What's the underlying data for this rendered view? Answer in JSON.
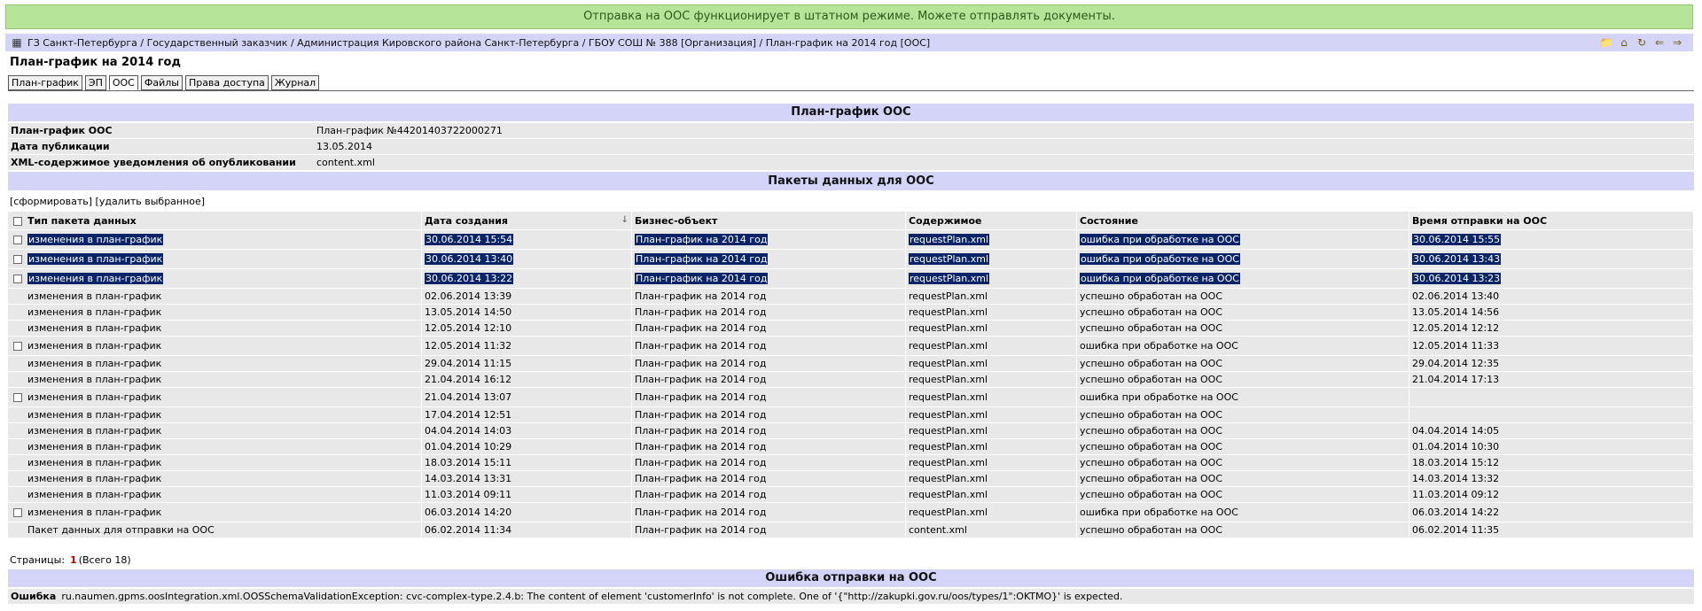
{
  "banner": "Отправка на ООС функционирует в штатном режиме. Можете отправлять документы.",
  "breadcrumb": "ГЗ Санкт-Петербурга / Государственный заказчик / Администрация Кировского района Санкт-Петербурга / ГБОУ СОШ № 388 [Организация] / План-график на 2014 год [ООС]",
  "page_title": "План-график на 2014 год",
  "tabs": [
    "План-график",
    "ЭП",
    "ООС",
    "Файлы",
    "Права доступа",
    "Журнал"
  ],
  "section1": {
    "title": "План-график ООС",
    "rows": [
      {
        "k": "План-график ООС",
        "v": "План-график №44201403722000271"
      },
      {
        "k": "Дата публикации",
        "v": "13.05.2014"
      },
      {
        "k": "XML-содержимое уведомления об опубликовании",
        "v": "content.xml"
      }
    ]
  },
  "section2": {
    "title": "Пакеты данных для ООС",
    "action_create": "[сформировать]",
    "action_delete": "[удалить выбранное]",
    "columns": [
      "Тип пакета данных",
      "Дата создания",
      "Бизнес-объект",
      "Содержимое",
      "Состояние",
      "Время отправки на ООС"
    ],
    "rows": [
      {
        "cb": true,
        "sel": true,
        "c": [
          "изменения в план-график",
          "30.06.2014 15:54",
          "План-график на 2014 год",
          "requestPlan.xml",
          "ошибка при обработке на ООС",
          "30.06.2014 15:55"
        ]
      },
      {
        "cb": true,
        "sel": true,
        "c": [
          "изменения в план-график",
          "30.06.2014 13:40",
          "План-график на 2014 год",
          "requestPlan.xml",
          "ошибка при обработке на ООС",
          "30.06.2014 13:43"
        ]
      },
      {
        "cb": true,
        "sel": true,
        "c": [
          "изменения в план-график",
          "30.06.2014 13:22",
          "План-график на 2014 год",
          "requestPlan.xml",
          "ошибка при обработке на ООС",
          "30.06.2014 13:23"
        ]
      },
      {
        "cb": false,
        "sel": false,
        "c": [
          "изменения в план-график",
          "02.06.2014 13:39",
          "План-график на 2014 год",
          "requestPlan.xml",
          "успешно обработан на ООС",
          "02.06.2014 13:40"
        ]
      },
      {
        "cb": false,
        "sel": false,
        "c": [
          "изменения в план-график",
          "13.05.2014 14:50",
          "План-график на 2014 год",
          "requestPlan.xml",
          "успешно обработан на ООС",
          "13.05.2014 14:56"
        ]
      },
      {
        "cb": false,
        "sel": false,
        "c": [
          "изменения в план-график",
          "12.05.2014 12:10",
          "План-график на 2014 год",
          "requestPlan.xml",
          "успешно обработан на ООС",
          "12.05.2014 12:12"
        ]
      },
      {
        "cb": true,
        "sel": false,
        "c": [
          "изменения в план-график",
          "12.05.2014 11:32",
          "План-график на 2014 год",
          "requestPlan.xml",
          "ошибка при обработке на ООС",
          "12.05.2014 11:33"
        ]
      },
      {
        "cb": false,
        "sel": false,
        "c": [
          "изменения в план-график",
          "29.04.2014 11:15",
          "План-график на 2014 год",
          "requestPlan.xml",
          "успешно обработан на ООС",
          "29.04.2014 12:35"
        ]
      },
      {
        "cb": false,
        "sel": false,
        "c": [
          "изменения в план-график",
          "21.04.2014 16:12",
          "План-график на 2014 год",
          "requestPlan.xml",
          "успешно обработан на ООС",
          "21.04.2014 17:13"
        ]
      },
      {
        "cb": true,
        "sel": false,
        "c": [
          "изменения в план-график",
          "21.04.2014 13:07",
          "План-график на 2014 год",
          "requestPlan.xml",
          "ошибка при обработке на ООС",
          ""
        ]
      },
      {
        "cb": false,
        "sel": false,
        "c": [
          "изменения в план-график",
          "17.04.2014 12:51",
          "План-график на 2014 год",
          "requestPlan.xml",
          "успешно обработан на ООС",
          ""
        ]
      },
      {
        "cb": false,
        "sel": false,
        "c": [
          "изменения в план-график",
          "04.04.2014 14:03",
          "План-график на 2014 год",
          "requestPlan.xml",
          "успешно обработан на ООС",
          "04.04.2014 14:05"
        ]
      },
      {
        "cb": false,
        "sel": false,
        "c": [
          "изменения в план-график",
          "01.04.2014 10:29",
          "План-график на 2014 год",
          "requestPlan.xml",
          "успешно обработан на ООС",
          "01.04.2014 10:30"
        ]
      },
      {
        "cb": false,
        "sel": false,
        "c": [
          "изменения в план-график",
          "18.03.2014 15:11",
          "План-график на 2014 год",
          "requestPlan.xml",
          "успешно обработан на ООС",
          "18.03.2014 15:12"
        ]
      },
      {
        "cb": false,
        "sel": false,
        "c": [
          "изменения в план-график",
          "14.03.2014 13:31",
          "План-график на 2014 год",
          "requestPlan.xml",
          "успешно обработан на ООС",
          "14.03.2014 13:32"
        ]
      },
      {
        "cb": false,
        "sel": false,
        "c": [
          "изменения в план-график",
          "11.03.2014 09:11",
          "План-график на 2014 год",
          "requestPlan.xml",
          "успешно обработан на ООС",
          "11.03.2014 09:12"
        ]
      },
      {
        "cb": true,
        "sel": false,
        "c": [
          "изменения в план-график",
          "06.03.2014 14:20",
          "План-график на 2014 год",
          "requestPlan.xml",
          "ошибка при обработке на ООС",
          "06.03.2014 14:22"
        ]
      },
      {
        "cb": false,
        "sel": false,
        "c": [
          "Пакет данных для отправки на ООС",
          "06.02.2014 11:34",
          "План-график на 2014 год",
          "content.xml",
          "успешно обработан на ООС",
          "06.02.2014 11:35"
        ]
      }
    ]
  },
  "pager": {
    "label": "Страницы:",
    "current": "1",
    "total": "(Всего 18)"
  },
  "section3": {
    "title": "Ошибка отправки на ООС",
    "key": "Ошибка",
    "value": "ru.naumen.gpms.oosIntegration.xml.OOSSchemaValidationException: cvc-complex-type.2.4.b: The content of element 'customerInfo' is not complete. One of '{\"http://zakupki.gov.ru/oos/types/1\":OKTMO}' is expected."
  }
}
